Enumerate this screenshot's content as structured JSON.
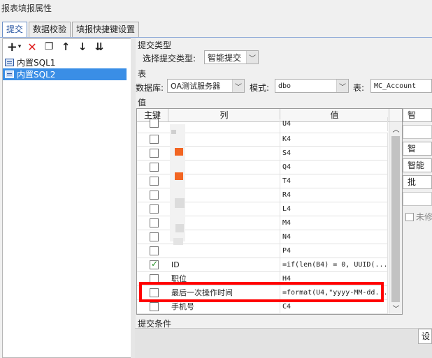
{
  "window": {
    "title": "报表填报属性"
  },
  "tabs": [
    "提交",
    "数据校验",
    "填报快捷键设置"
  ],
  "toolbar": {
    "icons": [
      "add-icon",
      "delete-icon",
      "copy-icon",
      "move-up-icon",
      "move-down-icon",
      "move-bottom-icon"
    ],
    "add_glyph": "+",
    "add_dropdown_glyph": "▾",
    "delete_glyph": "✕",
    "copy_glyph": "❐",
    "up_glyph": "↑",
    "down_glyph": "↓",
    "bottom_glyph": "⇊"
  },
  "tree": {
    "items": [
      {
        "label": "内置SQL1",
        "selected": false
      },
      {
        "label": "内置SQL2",
        "selected": true
      }
    ]
  },
  "submit_type": {
    "section_label": "提交类型",
    "select_label": "选择提交类型:",
    "value": "智能提交"
  },
  "table_section": {
    "section_label": "表",
    "db_label": "数据库:",
    "db_value": "OA测试服务器",
    "mode_label": "模式:",
    "mode_value": "dbo",
    "table_label": "表:",
    "table_value": "MC_Account"
  },
  "value_section": {
    "section_label": "值",
    "headers": {
      "key": "主键",
      "column": "列",
      "value": "值"
    },
    "rows": [
      {
        "key": false,
        "column": "",
        "value": "U4"
      },
      {
        "key": false,
        "column": "",
        "value": "K4"
      },
      {
        "key": false,
        "column": "",
        "value": "S4"
      },
      {
        "key": false,
        "column": "",
        "value": "Q4"
      },
      {
        "key": false,
        "column": "",
        "value": "T4"
      },
      {
        "key": false,
        "column": "",
        "value": "R4"
      },
      {
        "key": false,
        "column": "",
        "value": "L4"
      },
      {
        "key": false,
        "column": "",
        "value": "M4"
      },
      {
        "key": false,
        "column": "",
        "value": "N4"
      },
      {
        "key": false,
        "column": "",
        "value": "P4"
      },
      {
        "key": true,
        "column": "ID",
        "value": "=if(len(B4) = 0, UUID(..."
      },
      {
        "key": false,
        "column": "职位",
        "value": "H4"
      },
      {
        "key": false,
        "column": "最后一次操作时间",
        "value": "=format(U4,\"yyyy-MM-dd..."
      },
      {
        "key": false,
        "column": "手机号",
        "value": "C4"
      }
    ],
    "side_buttons": [
      "智",
      "智",
      "智能",
      "批"
    ],
    "side_checkbox_label": "未修"
  },
  "conditions": {
    "section_label": "提交条件",
    "button_label": "设"
  },
  "colors": {
    "accent": "#3a8ee6",
    "highlight": "#ff0000",
    "blur_orange": "#f26522"
  }
}
